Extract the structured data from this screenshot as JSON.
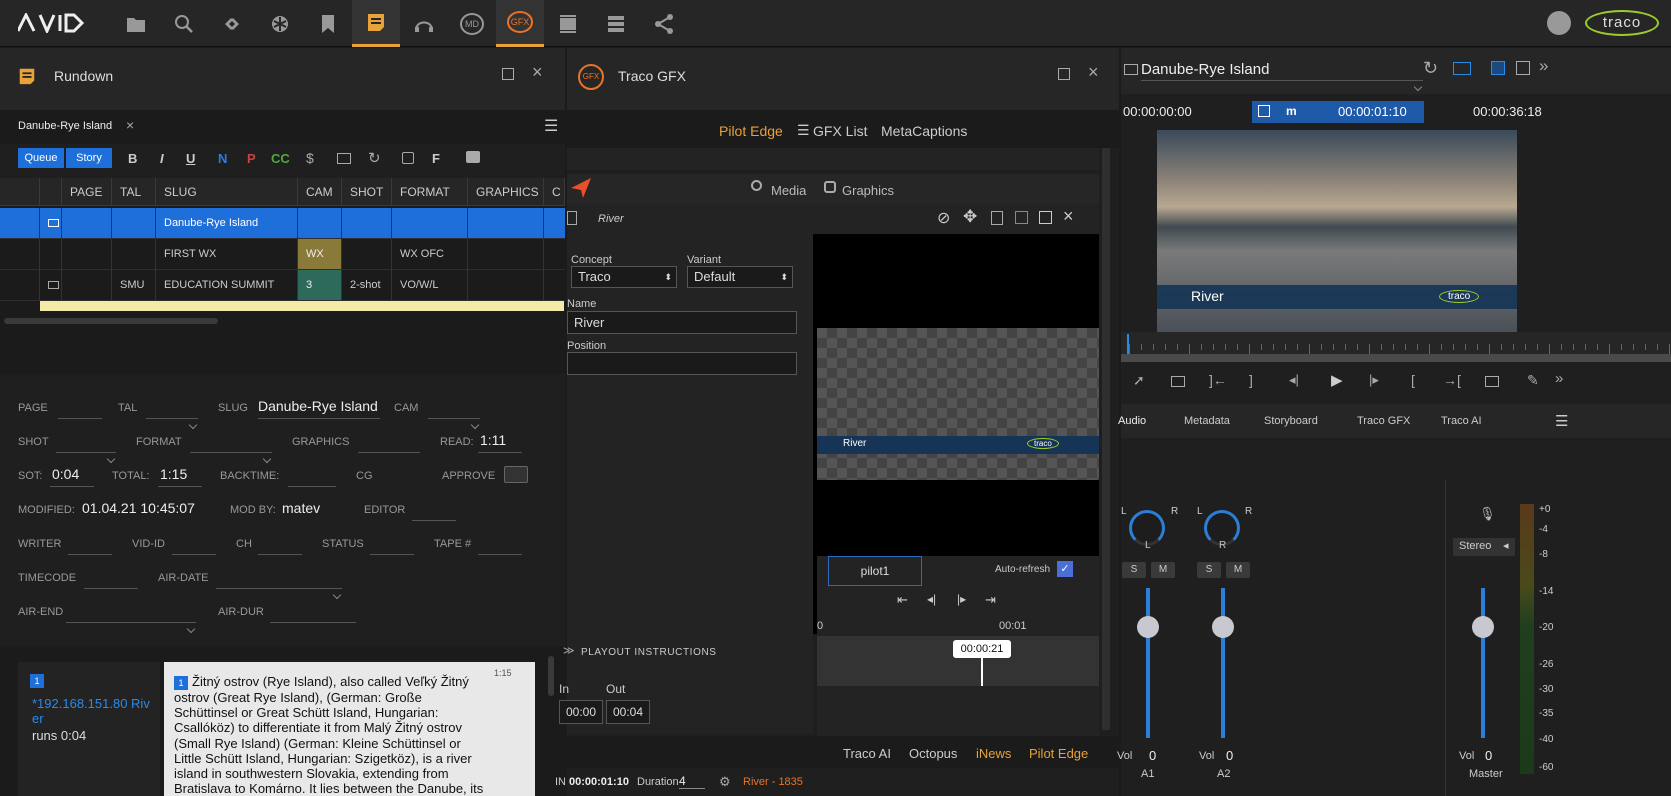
{
  "topbar": {
    "logo": "AVID",
    "brand": "traco",
    "icons": [
      "folder-icon",
      "search-icon",
      "connect-icon",
      "nexis-icon",
      "bookmark-icon",
      "rundown-icon",
      "headphones-icon",
      "md-icon",
      "gfx-icon",
      "storyboard-icon",
      "server-icon",
      "share-icon"
    ],
    "md_label": "MD",
    "gfx_label": "GFX"
  },
  "rundown": {
    "title": "Rundown",
    "tab": "Danube-Rye Island",
    "toolbar": {
      "queue": "Queue",
      "story": "Story",
      "bold": "B",
      "italic": "I",
      "underline": "U",
      "n": "N",
      "p": "P",
      "cc": "CC",
      "f": "F"
    },
    "columns": [
      "PAGE",
      "TAL",
      "SLUG",
      "CAM",
      "SHOT",
      "FORMAT",
      "GRAPHICS",
      "C"
    ],
    "rows": [
      {
        "page": "",
        "tal": "",
        "slug": "Danube-Rye Island",
        "cam": "",
        "shot": "",
        "format": "",
        "graphics": ""
      },
      {
        "page": "",
        "tal": "",
        "slug": "FIRST WX",
        "cam": "WX",
        "shot": "",
        "format": "WX OFC",
        "graphics": ""
      },
      {
        "page": "",
        "tal": "SMU",
        "slug": "EDUCATION SUMMIT",
        "cam": "3",
        "shot": "2-shot",
        "format": "VO/W/L",
        "graphics": ""
      }
    ],
    "form": {
      "page": "PAGE",
      "tal": "TAL",
      "slug": "SLUG",
      "slug_value": "Danube-Rye Island",
      "cam": "CAM",
      "shot": "SHOT",
      "format": "FORMAT",
      "graphics": "GRAPHICS",
      "read": "READ:",
      "read_value": "1:11",
      "sot": "SOT:",
      "sot_value": "0:04",
      "total": "TOTAL:",
      "total_value": "1:15",
      "backtime": "BACKTIME:",
      "cg": "CG",
      "approve": "APPROVE",
      "modified": "MODIFIED:",
      "modified_value": "01.04.21 10:45:07",
      "modby": "MOD BY:",
      "modby_value": "matev",
      "editor": "EDITOR",
      "writer": "WRITER",
      "vidid": "VID-ID",
      "ch": "CH",
      "status": "STATUS",
      "tape": "TAPE #",
      "timecode": "TIMECODE",
      "airdate": "AIR-DATE",
      "airend": "AIR-END",
      "airdur": "AIR-DUR"
    },
    "story": {
      "badge": "1",
      "cue_text": "*192.168.151.80 River",
      "runs": "runs 0:04",
      "time": "1:15",
      "text_badge": "1",
      "text": "Žitný ostrov (Rye Island), also called Veľký Žitný ostrov (Great Rye Island), (German: Große Schüttinsel or Great Schütt Island, Hungarian: Csallóköz) to differentiate it from Malý Žitný ostrov (Small Rye Island) (German: Kleine Schüttinsel or Little Schütt Island, Hungarian: Szigetköz), is a river island in southwestern Slovakia, extending from Bratislava to Komárno. It lies between the Danube, its tributary Little Danube and Váh. The island is a"
    }
  },
  "gfx": {
    "title": "Traco GFX",
    "tabs": [
      "Pilot Edge",
      "GFX List",
      "MetaCaptions"
    ],
    "media": "Media",
    "graphics": "Graphics",
    "template": "River",
    "concept_label": "Concept",
    "concept_value": "Traco",
    "variant_label": "Variant",
    "variant_value": "Default",
    "name_label": "Name",
    "name_value": "River",
    "position_label": "Position",
    "position_value": "",
    "preview_text": "River",
    "preview_logo": "traco",
    "pilot": "pilot1",
    "autorefresh": "Auto-refresh",
    "playout": "PLAYOUT INSTRUCTIONS",
    "in_label": "In",
    "out_label": "Out",
    "in_value": "00:00",
    "out_value": "00:04",
    "tl_start": "0",
    "tl_end": "00:01",
    "tl_cursor": "00:00:21",
    "bottom_tabs": [
      "Traco AI",
      "Octopus",
      "iNews",
      "Pilot Edge"
    ],
    "status_in_label": "IN",
    "status_in": "00:00:01:10",
    "status_dur_label": "Duration",
    "status_dur": "4",
    "status_clip": "River - 1835"
  },
  "player": {
    "clip": "Danube-Rye Island",
    "tc_in": "00:00:00:00",
    "mode": "m",
    "tc_pos": "00:00:01:10",
    "tc_out": "00:00:36:18",
    "overlay_text": "River",
    "overlay_logo": "traco",
    "tabs": [
      "Audio",
      "Metadata",
      "Storyboard",
      "Traco GFX",
      "Traco AI"
    ],
    "channels": [
      {
        "name": "A1",
        "knob_top_l": "L",
        "knob_top_r": "R",
        "knob_label": "L",
        "vol_label": "Vol",
        "vol": "0",
        "s": "S",
        "m": "M",
        "level": 0.78
      },
      {
        "name": "A2",
        "knob_top_l": "L",
        "knob_top_r": "R",
        "knob_label": "R",
        "vol_label": "Vol",
        "vol": "0",
        "s": "S",
        "m": "M",
        "level": 0.78
      }
    ],
    "master": {
      "name": "Master",
      "stereo": "Stereo",
      "vol_label": "Vol",
      "vol": "0",
      "level": 0.78
    },
    "meter_scale": [
      "+0",
      "-4",
      "-8",
      "-14",
      "-20",
      "-26",
      "-30",
      "-35",
      "-40",
      "-60"
    ]
  }
}
